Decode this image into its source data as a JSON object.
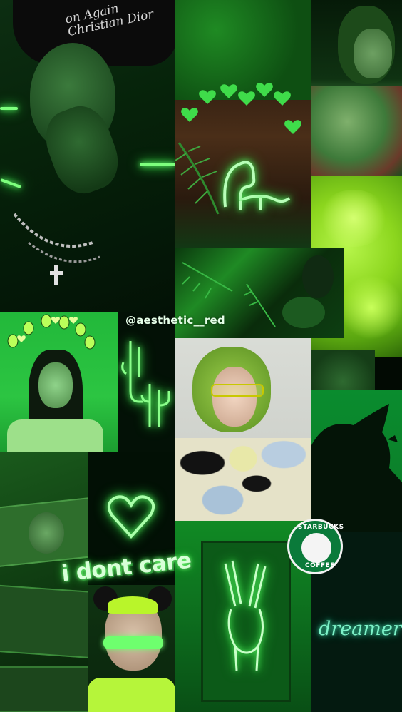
{
  "watermark": "@aesthetic__red",
  "captions": {
    "dont_care": "i dont care",
    "dreamer": "dreamer",
    "hat_text": "on Again\nChristian Dior"
  },
  "starbucks": {
    "top": "STARBUCKS",
    "bottom": "COFFEE"
  },
  "colors": {
    "neon_green": "#5dff6a",
    "lime": "#a8f03a",
    "dark": "#020a03",
    "teal_neon": "#7df2c8",
    "starbucks_green": "#0a7a3a"
  }
}
